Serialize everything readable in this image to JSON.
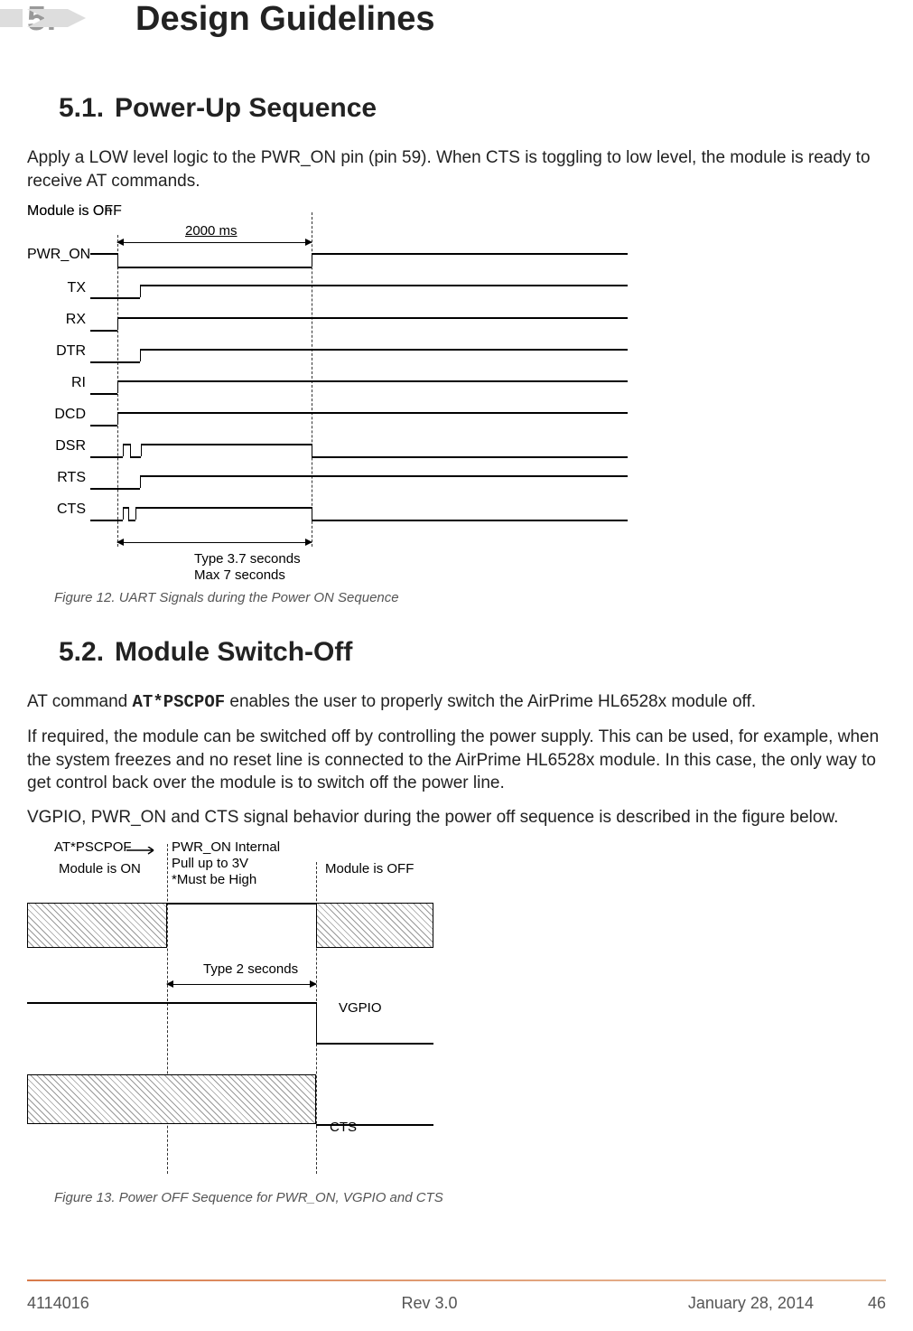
{
  "chapter": {
    "num": "5.",
    "title": "Design Guidelines"
  },
  "s51": {
    "num": "5.1.",
    "title": "Power-Up Sequence",
    "p": "Apply a LOW level logic to the PWR_ON pin (pin 59). When CTS is toggling to low level, the module is ready to receive AT commands."
  },
  "fig12": {
    "a_off": "Module is OFF",
    "a_on": "Module is On",
    "a_2000": "2000 ms",
    "a_type": "Type  3.7 seconds",
    "a_max": "Max 7 seconds",
    "signals": [
      "PWR_ON",
      "TX",
      "RX",
      "DTR",
      "RI",
      "DCD",
      "DSR",
      "RTS",
      "CTS"
    ],
    "caption": "Figure 12. UART Signals during the Power ON Sequence"
  },
  "s52": {
    "num": "5.2.",
    "title": "Module Switch-Off",
    "p1a": "AT command ",
    "p1b": "AT*PSCPOF",
    "p1c": " enables the user to properly switch the AirPrime HL6528x module off.",
    "p2": "If required, the module can be switched off by controlling the power supply. This can be used, for example, when the system freezes and no reset line is connected to the AirPrime HL6528x module. In this case, the only way to get control back over the module is to switch off the power line.",
    "p3": "VGPIO, PWR_ON and CTS signal behavior during the power off sequence is described in the figure below."
  },
  "fig13": {
    "a_at": "AT*PSCPOF",
    "a_pull1": "PWR_ON Internal",
    "a_pull2": "Pull up to 3V",
    "a_pull3": "*Must be High",
    "a_on": "Module is ON",
    "a_off": "Module is OFF",
    "a_type2": "Type 2 seconds",
    "vgpio": "VGPIO",
    "cts": "CTS",
    "caption": "Figure 13. Power OFF Sequence for PWR_ON, VGPIO and CTS"
  },
  "footer": {
    "left": "4114016",
    "mid": "Rev 3.0",
    "date": "January 28, 2014",
    "page": "46"
  },
  "chart_data": [
    {
      "type": "timing",
      "title": "UART Signals during the Power ON Sequence",
      "signals": [
        "PWR_ON",
        "TX",
        "RX",
        "DTR",
        "RI",
        "DCD",
        "DSR",
        "RTS",
        "CTS"
      ],
      "annotations": {
        "pwr_on_low_pulse_ms": 2000,
        "startup_typical_s": 3.7,
        "startup_max_s": 7,
        "before_state": "Module is OFF",
        "after_state": "Module is On"
      }
    },
    {
      "type": "timing",
      "title": "Power OFF Sequence for PWR_ON, VGPIO and CTS",
      "signals": [
        "PWR_ON",
        "VGPIO",
        "CTS"
      ],
      "annotations": {
        "trigger": "AT*PSCPOF",
        "pwr_on_note": "PWR_ON Internal Pull up to 3V *Must be High",
        "shutdown_typical_s": 2,
        "before_state": "Module is ON",
        "after_state": "Module is OFF"
      }
    }
  ]
}
